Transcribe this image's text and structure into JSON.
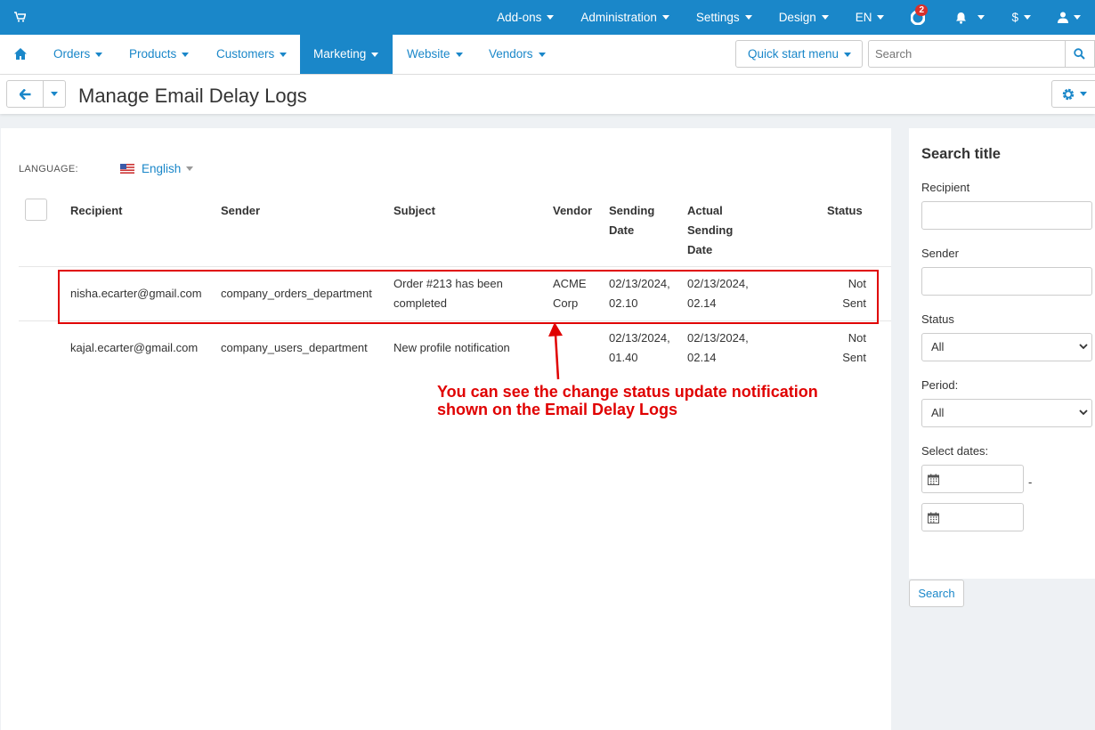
{
  "topbar": {
    "cart_icon": "cart-icon",
    "items": [
      {
        "label": "Add-ons"
      },
      {
        "label": "Administration"
      },
      {
        "label": "Settings"
      },
      {
        "label": "Design"
      },
      {
        "label": "EN"
      }
    ],
    "help_badge": "2",
    "currency": "$",
    "accent": "#1a87c9"
  },
  "nav": {
    "items": [
      {
        "label": "Orders"
      },
      {
        "label": "Products"
      },
      {
        "label": "Customers"
      },
      {
        "label": "Marketing"
      },
      {
        "label": "Website"
      },
      {
        "label": "Vendors"
      }
    ],
    "active": "Marketing",
    "quick_start": "Quick start menu",
    "search_placeholder": "Search"
  },
  "page": {
    "title": "Manage Email Delay Logs"
  },
  "content": {
    "language_label": "LANGUAGE:",
    "language_value": "English",
    "columns": {
      "recipient": "Recipient",
      "sender": "Sender",
      "subject": "Subject",
      "vendor": "Vendor",
      "sending_date_1": "Sending",
      "sending_date_2": "Date",
      "actual_1": "Actual",
      "actual_2": "Sending",
      "actual_3": "Date",
      "status": "Status"
    },
    "rows": [
      {
        "recipient": "nisha.ecarter@gmail.com",
        "sender": "company_orders_department",
        "subject_1": "Order #213 has been",
        "subject_2": "completed",
        "vendor_1": "ACME",
        "vendor_2": "Corp",
        "sending_1": "02/13/2024,",
        "sending_2": "02.10",
        "actual_1": "02/13/2024,",
        "actual_2": "02.14",
        "status_1": "Not",
        "status_2": "Sent"
      },
      {
        "recipient": "kajal.ecarter@gmail.com",
        "sender": "company_users_department",
        "subject": "New profile notification",
        "sending_1": "02/13/2024,",
        "sending_2": "01.40",
        "actual_1": "02/13/2024,",
        "actual_2": "02.14",
        "status_1": "Not",
        "status_2": "Sent"
      }
    ],
    "annotation_1": "You can see the change status update notification",
    "annotation_2": "shown on the Email Delay Logs",
    "annotation_color": "#e00000"
  },
  "sidebar": {
    "title": "Search title",
    "recipient_label": "Recipient",
    "sender_label": "Sender",
    "status_label": "Status",
    "status_value": "All",
    "period_label": "Period:",
    "period_value": "All",
    "dates_label": "Select dates:",
    "dash": "-",
    "search_button": "Search"
  }
}
